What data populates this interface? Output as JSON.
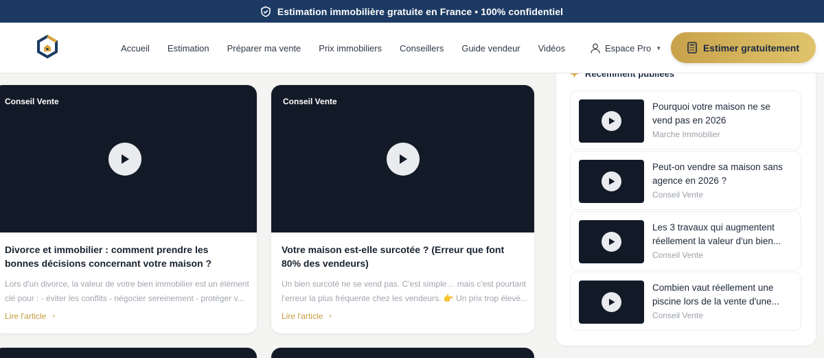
{
  "topbar": {
    "text": "Estimation immobilière gratuite en France • 100% confidentiel",
    "icon": "shield-check-icon"
  },
  "header": {
    "logo_icon": "house-logo-icon",
    "nav": [
      "Accueil",
      "Estimation",
      "Préparer ma vente",
      "Prix immobiliers",
      "Conseillers",
      "Guide vendeur",
      "Vidéos"
    ],
    "espace_pro": "Espace Pro",
    "cta": "Estimer gratuitement"
  },
  "cards": [
    {
      "badge": "Conseil Vente",
      "title": "Divorce et immobilier : comment prendre les bonnes décisions concernant votre maison ?",
      "excerpt_lines": [
        "Lors d'un divorce, la valeur de votre bien immobilier est un élément",
        "clé pour : - éviter les conflits - négocier sereinement - protéger v..."
      ],
      "read_more": "Lire l'article"
    },
    {
      "badge": "Conseil Vente",
      "title": "Votre maison est-elle surcotée ? (Erreur que font 80% des vendeurs)",
      "excerpt_lines": [
        "Un bien surcoté ne se vend pas. C'est simple… mais c'est pourtant",
        "l'erreur la plus fréquente chez les vendeurs. 👉 Un prix trop élevé..."
      ],
      "read_more": "Lire l'article"
    }
  ],
  "sidebar": {
    "heading": "Récemment publiées",
    "items": [
      {
        "title_lines": [
          "Pourquoi votre maison ne se",
          "vend pas en 2026"
        ],
        "category": "Marche Immobilier"
      },
      {
        "title_lines": [
          "Peut-on vendre sa maison sans",
          "agence en 2026 ?"
        ],
        "category": "Conseil Vente"
      },
      {
        "title_lines": [
          "Les 3 travaux qui augmentent",
          "réellement la valeur d'un bien..."
        ],
        "category": "Conseil Vente"
      },
      {
        "title_lines": [
          "Combien vaut réellement une",
          "piscine lors de la vente d'une..."
        ],
        "category": "Conseil Vente"
      }
    ]
  },
  "colors": {
    "topbar": "#1c3a63",
    "accent_gold": "#c8a24a",
    "video_bg": "#131a27"
  }
}
